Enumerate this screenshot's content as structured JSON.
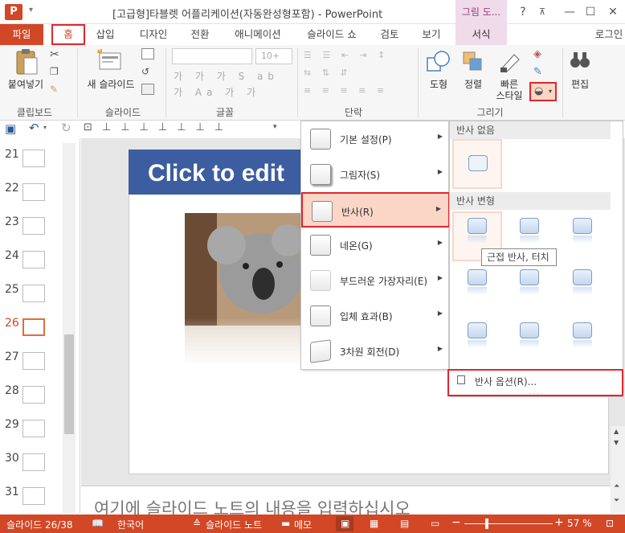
{
  "window": {
    "app_logo": "P",
    "title": "[고급형]타블렛 어플리케이션(자동완성형포함) - PowerPoint",
    "context_tab_title": "그림 도...",
    "help": "?",
    "login": "로그인"
  },
  "tabs": [
    "파일",
    "홈",
    "삽입",
    "디자인",
    "전환",
    "애니메이션",
    "슬라이드 쇼",
    "검토",
    "보기",
    "서식"
  ],
  "ribbon": {
    "paste": "붙여넣기",
    "new_slide": "새 슬라이드",
    "font_size": "10+",
    "shape": "도형",
    "arrange": "정렬",
    "quick_style": "빠른\n스타일",
    "quick_style_1": "빠른",
    "quick_style_2": "스타일",
    "edit": "편집",
    "groups": [
      "클립보드",
      "슬라이드",
      "글꼴",
      "단락",
      "그리기"
    ]
  },
  "thumbnails": [
    {
      "num": "21"
    },
    {
      "num": "22"
    },
    {
      "num": "23"
    },
    {
      "num": "24"
    },
    {
      "num": "25"
    },
    {
      "num": "26"
    },
    {
      "num": "27"
    },
    {
      "num": "28"
    },
    {
      "num": "29"
    },
    {
      "num": "30"
    },
    {
      "num": "31"
    }
  ],
  "slide": {
    "title": "Click to edit"
  },
  "notes_placeholder": "여기에 슬라이드 노트의 내용을 입력하십시오",
  "menu": [
    {
      "label": "기본 설정(P)"
    },
    {
      "label": "그림자(S)"
    },
    {
      "label": "반사(R)"
    },
    {
      "label": "네온(G)"
    },
    {
      "label": "부드러운 가장자리(E)"
    },
    {
      "label": "입체 효과(B)"
    },
    {
      "label": "3차원 회전(D)"
    }
  ],
  "gallery": {
    "no_reflection": "반사 없음",
    "variations": "반사 변형",
    "tooltip": "근접 반사, 터치",
    "options": "반사 옵션(R)..."
  },
  "status": {
    "slide_counter": "슬라이드 26/38",
    "language": "한국어",
    "notes": "슬라이드 노트",
    "comments": "메모",
    "zoom": "57 %",
    "minus": "−",
    "plus": "+"
  },
  "colors": {
    "accent": "#d24726",
    "highlight": "#e0262b",
    "title_bar": "#3c5d9f"
  }
}
